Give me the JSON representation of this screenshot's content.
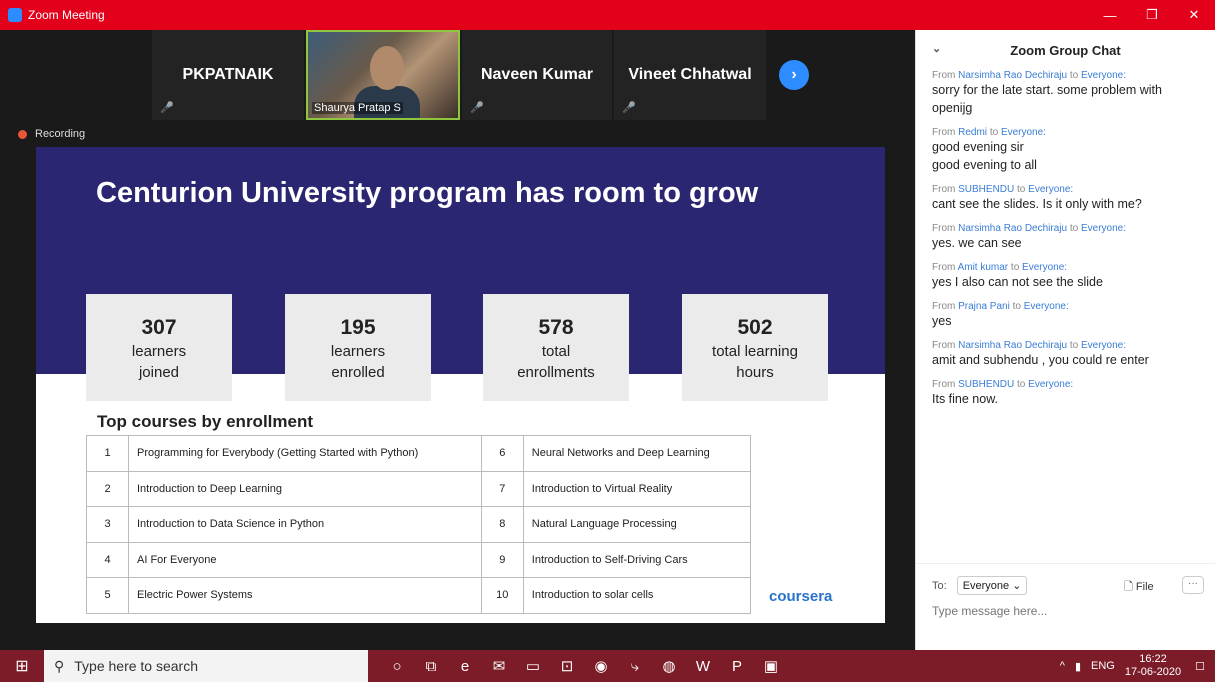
{
  "window": {
    "title": "Zoom Meeting",
    "controls": [
      "—",
      "❐",
      "✕"
    ]
  },
  "participants": [
    {
      "name": "PKPATNAIK",
      "muted": true
    },
    {
      "name": "Shaurya Pratap S",
      "video": true
    },
    {
      "name": "Naveen Kumar",
      "muted": true
    },
    {
      "name": "Vineet Chhatwal",
      "muted": true
    }
  ],
  "next_icon": "chevron-right-icon",
  "recording_label": "Recording",
  "slide": {
    "title": "Centurion University program has room to grow",
    "stats": [
      {
        "num": "307",
        "l1": "learners",
        "l2": "joined"
      },
      {
        "num": "195",
        "l1": "learners",
        "l2": "enrolled"
      },
      {
        "num": "578",
        "l1": "total",
        "l2": "enrollments"
      },
      {
        "num": "502",
        "l1": "total learning",
        "l2": "hours"
      }
    ],
    "courses_heading": "Top courses by enrollment",
    "courses": [
      {
        "n1": "1",
        "c1": "Programming for Everybody (Getting Started with Python)",
        "n2": "6",
        "c2": "Neural Networks and Deep Learning"
      },
      {
        "n1": "2",
        "c1": "Introduction to Deep Learning",
        "n2": "7",
        "c2": "Introduction to Virtual Reality"
      },
      {
        "n1": "3",
        "c1": "Introduction to Data Science in Python",
        "n2": "8",
        "c2": "Natural Language Processing"
      },
      {
        "n1": "4",
        "c1": "AI For Everyone",
        "n2": "9",
        "c2": "Introduction to Self-Driving Cars"
      },
      {
        "n1": "5",
        "c1": "Electric Power Systems",
        "n2": "10",
        "c2": "Introduction to solar cells"
      }
    ],
    "logo": "coursera"
  },
  "chat": {
    "title": "Zoom Group Chat",
    "messages": [
      {
        "from": "Narsimha Rao Dechiraju",
        "to": "Everyone:",
        "lines": [
          "sorry for the late start. some problem with openijg"
        ]
      },
      {
        "from": "Redmi",
        "to": "Everyone:",
        "lines": [
          "good evening sir",
          "good evening to all"
        ]
      },
      {
        "from": "SUBHENDU",
        "to": "Everyone:",
        "lines": [
          "cant see the slides. Is it only with me?"
        ]
      },
      {
        "from": "Narsimha Rao Dechiraju",
        "to": "Everyone:",
        "lines": [
          "yes. we can see"
        ]
      },
      {
        "from": "Amit kumar",
        "to": "Everyone:",
        "lines": [
          "yes I also can not see the slide"
        ]
      },
      {
        "from": "Prajna Pani",
        "to": "Everyone:",
        "lines": [
          "yes"
        ]
      },
      {
        "from": "Narsimha Rao Dechiraju",
        "to": "Everyone:",
        "lines": [
          "amit and subhendu , you could re enter"
        ]
      },
      {
        "from": "SUBHENDU",
        "to": "Everyone:",
        "lines": [
          "Its fine now."
        ]
      }
    ],
    "from_word": "From",
    "to_word": "to",
    "to_label": "To:",
    "recipient": "Everyone ⌄",
    "file_label": "File",
    "more_label": "···",
    "input_placeholder": "Type message here..."
  },
  "taskbar": {
    "search_placeholder": "Type here to search",
    "lang": "ENG",
    "time": "16:22",
    "date": "17-06-2020"
  },
  "colors": {
    "zoom_red": "#e2001a",
    "slide_purple": "#2b2671",
    "zoom_blue": "#2d8cff",
    "taskbar": "#7b1c28"
  }
}
